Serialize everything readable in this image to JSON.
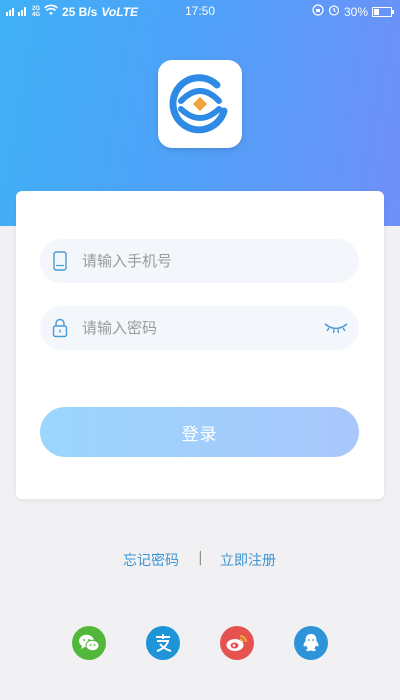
{
  "status_bar": {
    "network_small": "2G 4G",
    "net_speed": "25 B/s",
    "volte": "VoLTE",
    "time": "17:50",
    "battery": "30%",
    "battery_level": 0.3
  },
  "login": {
    "phone_placeholder": "请输入手机号",
    "password_placeholder": "请输入密码",
    "login_label": "登录"
  },
  "links": {
    "forgot_password": "忘记密码",
    "separator": "|",
    "register": "立即注册"
  },
  "social": [
    {
      "name": "wechat",
      "icon": "wechat-icon",
      "color": "#51b83b"
    },
    {
      "name": "alipay",
      "icon": "alipay-icon",
      "color": "#1e94d9"
    },
    {
      "name": "weibo",
      "icon": "weibo-icon",
      "color": "#e5524f"
    },
    {
      "name": "qq",
      "icon": "qq-icon",
      "color": "#2d94d9"
    }
  ],
  "colors": {
    "header_start": "#3fb0f6",
    "header_end": "#6f8ff8",
    "link": "#3a93d3",
    "button_start": "#9bd6fd",
    "button_end": "#a9c7fb"
  }
}
